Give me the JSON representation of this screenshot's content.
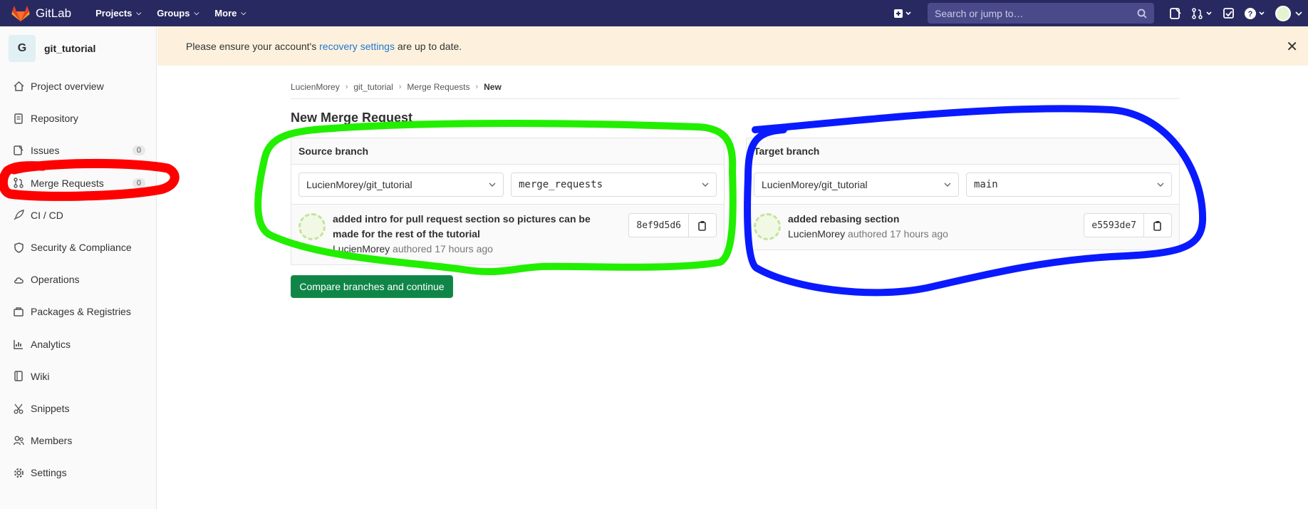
{
  "nav": {
    "brand": "GitLab",
    "menu": [
      {
        "label": "Projects"
      },
      {
        "label": "Groups"
      },
      {
        "label": "More"
      }
    ],
    "search_placeholder": "Search or jump to…"
  },
  "sidebar": {
    "project_initial": "G",
    "project_name": "git_tutorial",
    "items": [
      {
        "label": "Project overview",
        "icon": "home-icon"
      },
      {
        "label": "Repository",
        "icon": "doc-icon"
      },
      {
        "label": "Issues",
        "icon": "issues-icon",
        "count": "0"
      },
      {
        "label": "Merge Requests",
        "icon": "merge-request-icon",
        "count": "0"
      },
      {
        "label": "CI / CD",
        "icon": "rocket-icon"
      },
      {
        "label": "Security & Compliance",
        "icon": "shield-icon"
      },
      {
        "label": "Operations",
        "icon": "cloud-icon"
      },
      {
        "label": "Packages & Registries",
        "icon": "package-icon"
      },
      {
        "label": "Analytics",
        "icon": "chart-icon"
      },
      {
        "label": "Wiki",
        "icon": "book-icon"
      },
      {
        "label": "Snippets",
        "icon": "scissors-icon"
      },
      {
        "label": "Members",
        "icon": "users-icon"
      },
      {
        "label": "Settings",
        "icon": "gear-icon"
      }
    ]
  },
  "alert": {
    "prefix": "Please ensure your account's ",
    "link": "recovery settings",
    "suffix": " are up to date."
  },
  "breadcrumb": [
    "LucienMorey",
    "git_tutorial",
    "Merge Requests",
    "New"
  ],
  "page_title": "New Merge Request",
  "source": {
    "heading": "Source branch",
    "project": "LucienMorey/git_tutorial",
    "branch": "merge_requests",
    "commit_title_line1": "added intro for pull request section so pictures can be",
    "commit_title_line2": "made for the rest of the tutorial",
    "author": "LucienMorey",
    "authored": " authored 17 hours ago",
    "sha": "8ef9d5d6"
  },
  "target": {
    "heading": "Target branch",
    "project": "LucienMorey/git_tutorial",
    "branch": "main",
    "commit_title": "added rebasing section",
    "author": "LucienMorey",
    "authored": " authored 17 hours ago",
    "sha": "e5593de7"
  },
  "compare_button": "Compare branches and continue",
  "annotation_colors": {
    "sidebar": "#ff0000",
    "source": "#22ee00",
    "target": "#0a1aff"
  }
}
